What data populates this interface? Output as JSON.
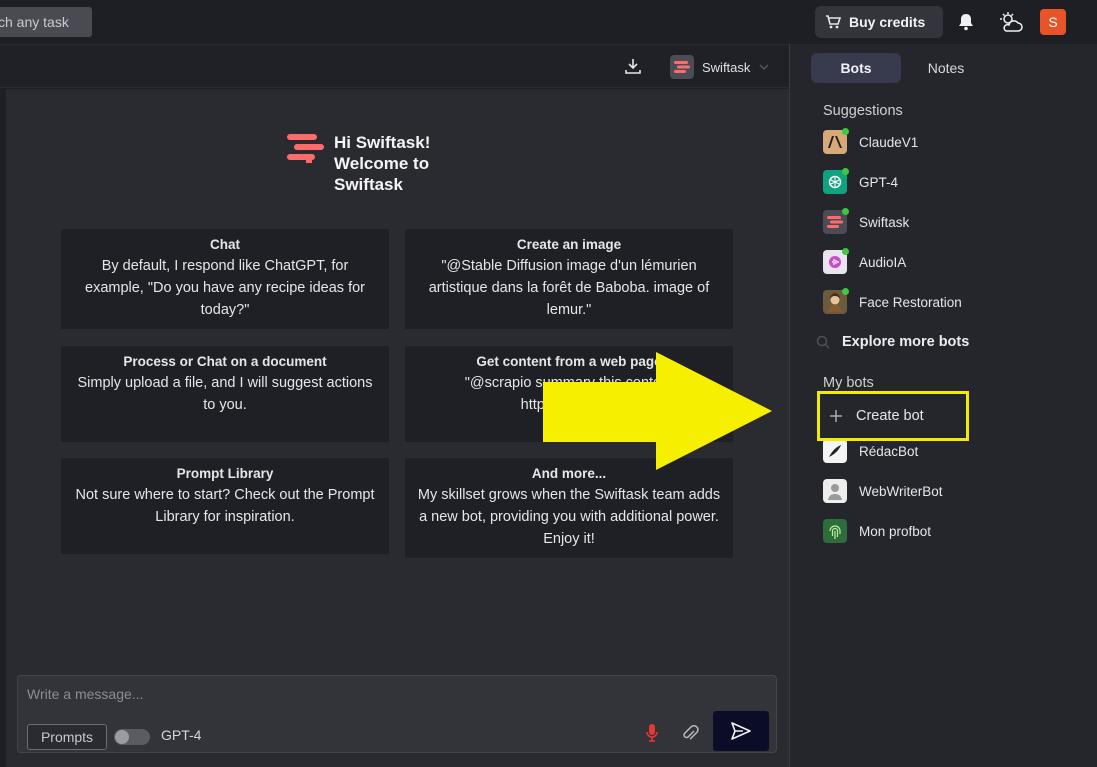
{
  "topbar": {
    "search_text": "ch any task",
    "buy_credits": "Buy credits",
    "avatar_letter": "S"
  },
  "chat_header": {
    "bot_name": "Swiftask"
  },
  "welcome": {
    "greeting": "Hi Swiftask! Welcome to Swiftask"
  },
  "cards": [
    {
      "title": "Chat",
      "body": "By default, I respond like ChatGPT, for example, \"Do you have any recipe ideas for today?\""
    },
    {
      "title": "Create an image",
      "body": "\"@Stable Diffusion image d'un lémurien artistique dans la forêt de Baboba. image of lemur.\""
    },
    {
      "title": "Process or Chat on a document",
      "body": "Simply upload a file, and I will suggest actions to you."
    },
    {
      "title": "Get content from a web page",
      "body": "\"@scrapio summary this content https://www.wo"
    },
    {
      "title": "Prompt Library",
      "body": "Not sure where to start? Check out the Prompt Library for inspiration."
    },
    {
      "title": "And more...",
      "body": "My skillset grows when the Swiftask team adds a new bot, providing you with additional power. Enjoy it!"
    }
  ],
  "composer": {
    "placeholder": "Write a message...",
    "prompts_label": "Prompts",
    "model_label": "GPT-4"
  },
  "panel": {
    "tabs": [
      "Bots",
      "Notes"
    ],
    "suggestions_label": "Suggestions",
    "suggestions": [
      "ClaudeV1",
      "GPT-4",
      "Swiftask",
      "AudioIA",
      "Face Restoration"
    ],
    "explore_label": "Explore more bots",
    "my_bots_label": "My bots",
    "create_bot_label": "Create bot",
    "my_bots": [
      "RédacBot",
      "WebWriterBot",
      "Mon profbot"
    ]
  },
  "colors": {
    "highlight": "#f2ec00",
    "accent_logo": "#ff6b6b",
    "online_dot": "#3cc940",
    "record_red": "#e53935"
  }
}
